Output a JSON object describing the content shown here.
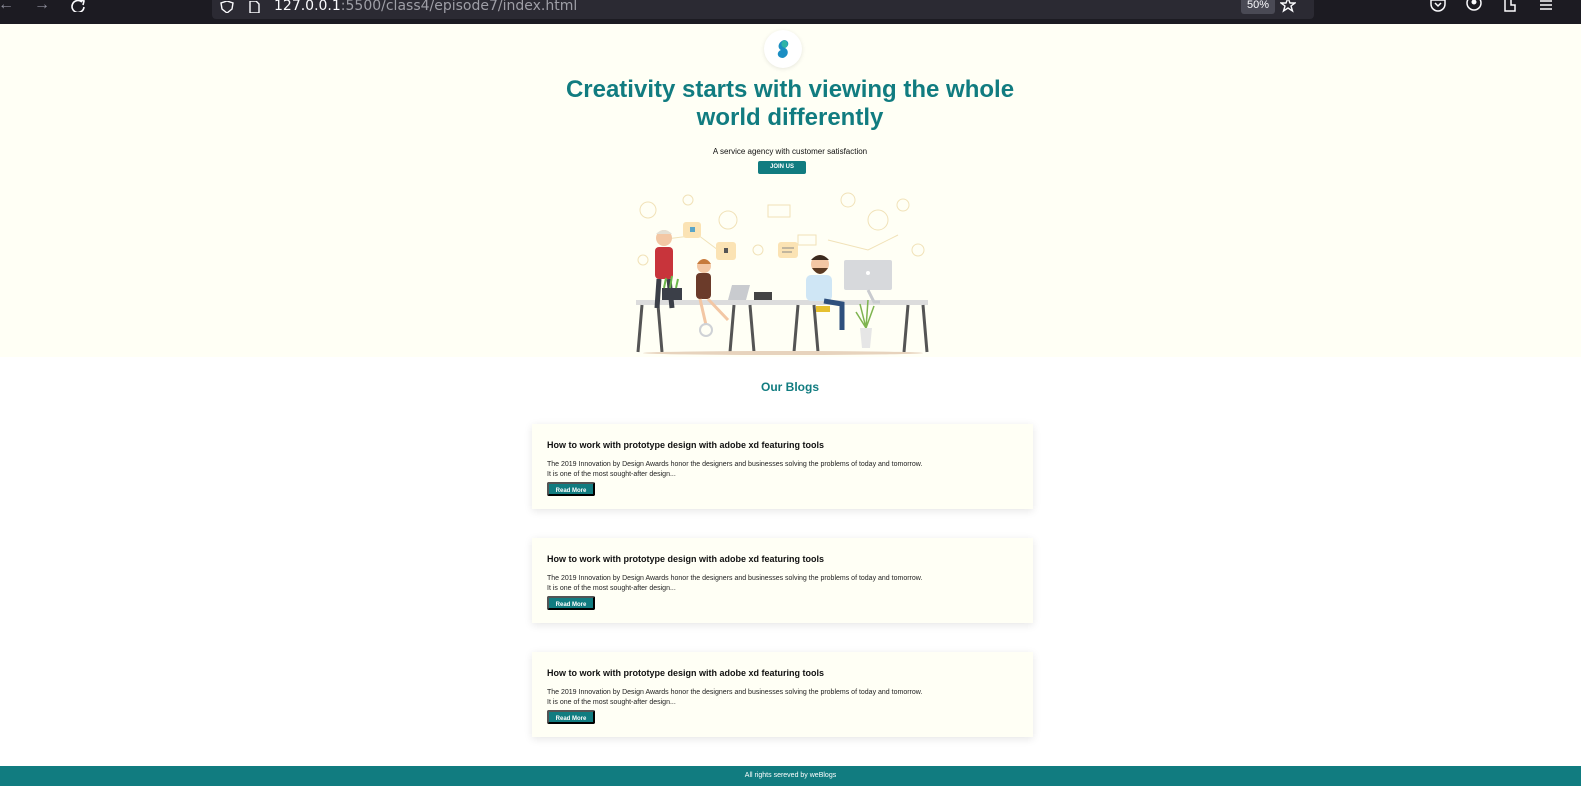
{
  "browser": {
    "url_host": "127.0.0.1",
    "url_rest": ":5500/class4/episode7/index.html",
    "zoom": "50%"
  },
  "hero": {
    "title": "Creativity starts with viewing the whole world differently",
    "subtitle": "A service agency with customer satisfaction",
    "cta_label": "JOIN US"
  },
  "blogs": {
    "heading": "Our Blogs",
    "items": [
      {
        "title": "How to work with prototype design with adobe xd featuring tools",
        "excerpt": "The 2019 Innovation by Design Awards honor the designers and businesses solving the problems of today and tomorrow. It is one of the most sought-after design...",
        "button_label": "Read More"
      },
      {
        "title": "How to work with prototype design with adobe xd featuring tools",
        "excerpt": "The 2019 Innovation by Design Awards honor the designers and businesses solving the problems of today and tomorrow. It is one of the most sought-after design...",
        "button_label": "Read More"
      },
      {
        "title": "How to work with prototype design with adobe xd featuring tools",
        "excerpt": "The 2019 Innovation by Design Awards honor the designers and businesses solving the problems of today and tomorrow. It is one of the most sought-after design...",
        "button_label": "Read More"
      }
    ]
  },
  "footer": {
    "text": "All rights sereved by weBlogs"
  },
  "colors": {
    "brand": "#117c80",
    "hero_bg": "#fffff5",
    "chrome_bg": "#1c1b22"
  }
}
